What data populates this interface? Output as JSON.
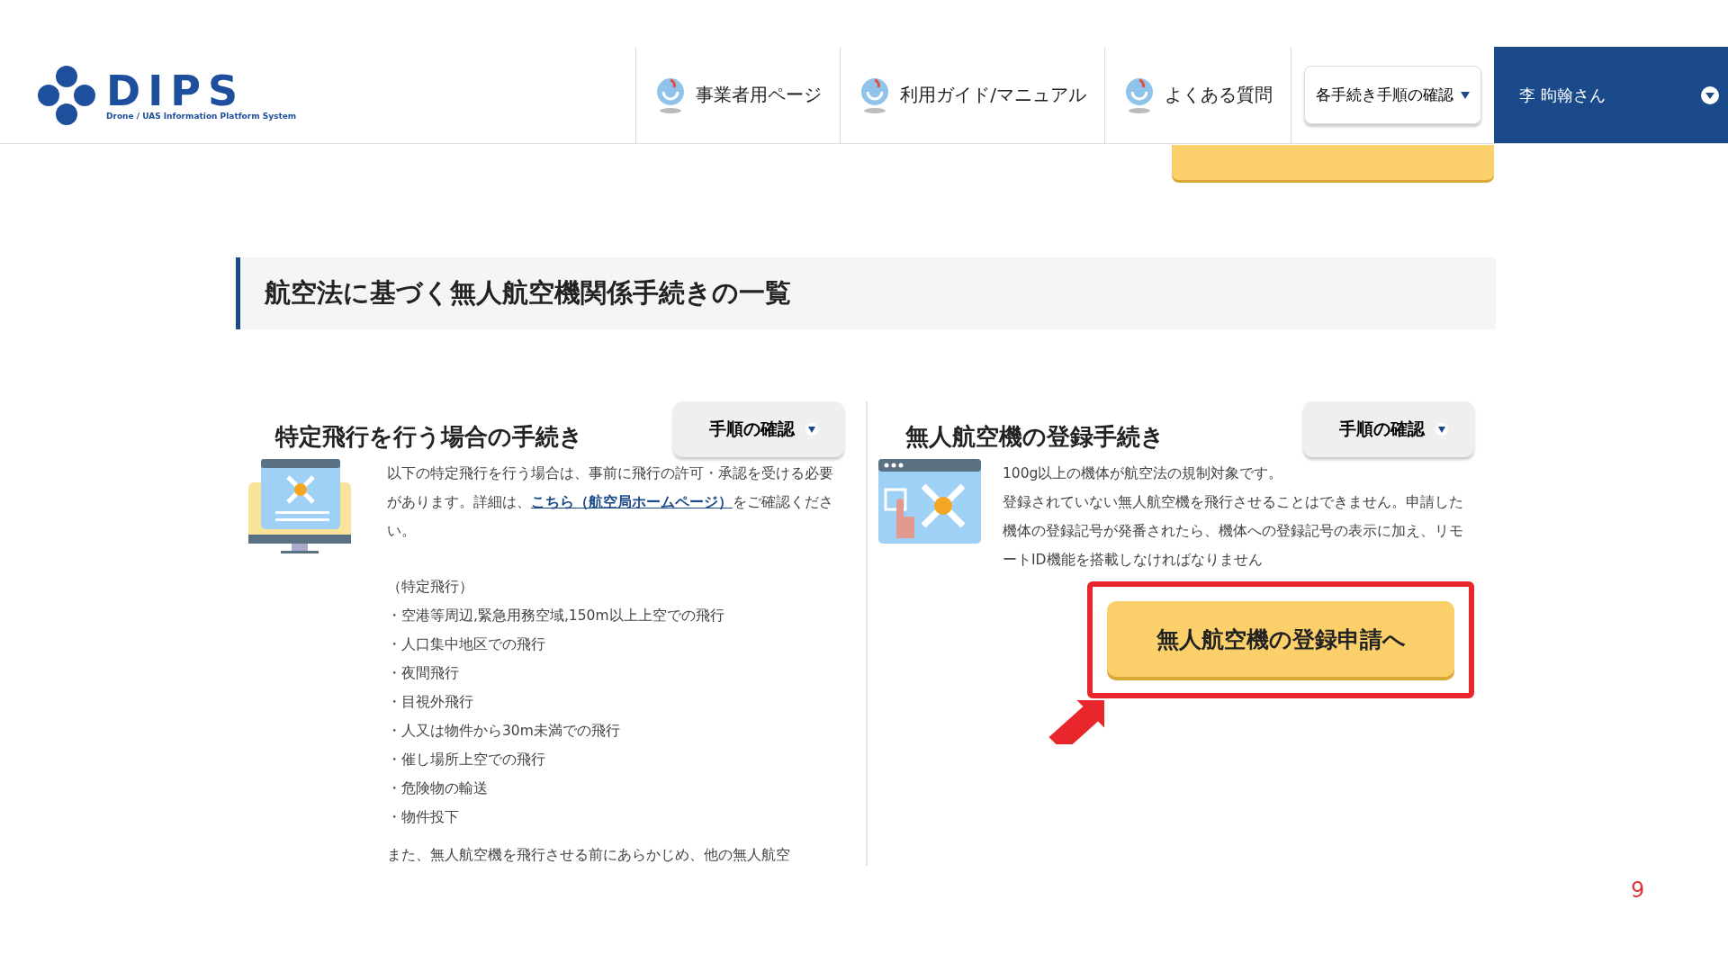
{
  "header": {
    "logo_text": "DIPS",
    "logo_subtitle": "Drone / UAS Information Platform System",
    "nav": [
      {
        "label": "事業者用ページ"
      },
      {
        "label": "利用ガイド/マニュアル"
      },
      {
        "label": "よくある質問"
      }
    ],
    "procedures_menu": "各手続き手順の確認",
    "user": "李 昫翰さん"
  },
  "section_title": "航空法に基づく無人航空機関係手続きの一覧",
  "panels": [
    {
      "title": "特定飛行を行う場合の手続き",
      "button": "手順の確認",
      "kind": "monitor",
      "paragraphs": [
        {
          "before": "以下の特定飛行を行う場合は、事前に飛行の許可・承認を受ける必要があります。詳細は、",
          "link": "こちら（航空局ホームページ）",
          "after": "をご確認ください。"
        }
      ],
      "list_heading": "（特定飛行）",
      "list": [
        "・空港等周辺,緊急用務空域,150m以上上空での飛行",
        "・人口集中地区での飛行",
        "・夜間飛行",
        "・目視外飛行",
        "・人又は物件から30m未満での飛行",
        "・催し場所上空での飛行",
        "・危険物の輸送",
        "・物件投下"
      ],
      "cut_text": "また、無人航空機を飛行させる前にあらかじめ、他の無人航空"
    },
    {
      "title": "無人航空機の登録手続き",
      "button": "手順の確認",
      "kind": "window",
      "paragraphs": [
        {
          "before": "100g以上の機体が航空法の規制対象です。"
        },
        {
          "before": "登録されていない無人航空機を飛行させることはできません。申請した機体の登録記号が発番されたら、機体への登録記号の表示に加え、リモートID機能を搭載しなければなりません"
        }
      ],
      "action": "無人航空機の登録申請へ",
      "highlighted": true
    }
  ],
  "page_number": "9"
}
